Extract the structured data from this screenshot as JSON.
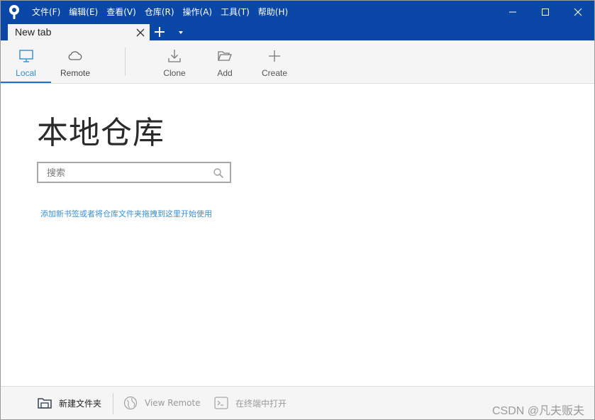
{
  "menubar": {
    "items": [
      "文件(F)",
      "编辑(E)",
      "查看(V)",
      "仓库(R)",
      "操作(A)",
      "工具(T)",
      "帮助(H)"
    ]
  },
  "tabs": [
    {
      "label": "New tab",
      "active": true
    }
  ],
  "toolbar": {
    "local_label": "Local",
    "remote_label": "Remote",
    "clone_label": "Clone",
    "add_label": "Add",
    "create_label": "Create"
  },
  "main": {
    "title": "本地仓库",
    "search_placeholder": "搜索",
    "hint_text": "添加新书签或者将仓库文件夹拖拽到这里开始使用"
  },
  "bottombar": {
    "new_folder_label": "新建文件夹",
    "view_remote_label": "View Remote",
    "open_terminal_label": "在终端中打开"
  },
  "watermark": "CSDN @凡夫贩夫",
  "colors": {
    "titlebar": "#0b47a6",
    "accent": "#1f6fcf",
    "link": "#3a8fd6"
  }
}
